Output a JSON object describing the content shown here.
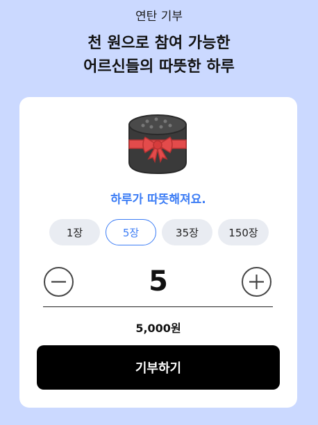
{
  "header": {
    "subtitle": "연탄 기부",
    "headline_line1": "천 원으로 참여 가능한",
    "headline_line2": "어르신들의 따뜻한 하루"
  },
  "card": {
    "illustration": "coal-briquette-gift-with-red-ribbon",
    "tagline": "하루가 따뜻해져요.",
    "options": [
      {
        "label": "1장",
        "selected": false
      },
      {
        "label": "5장",
        "selected": true
      },
      {
        "label": "35장",
        "selected": false
      },
      {
        "label": "150장",
        "selected": false
      }
    ],
    "quantity": "5",
    "icons": {
      "decrease": "minus-circle-icon",
      "increase": "plus-circle-icon"
    },
    "amount": "5,000원",
    "donate_label": "기부하기"
  },
  "colors": {
    "background": "#cbd9ff",
    "accent": "#3b7cf5",
    "button": "#000000"
  }
}
